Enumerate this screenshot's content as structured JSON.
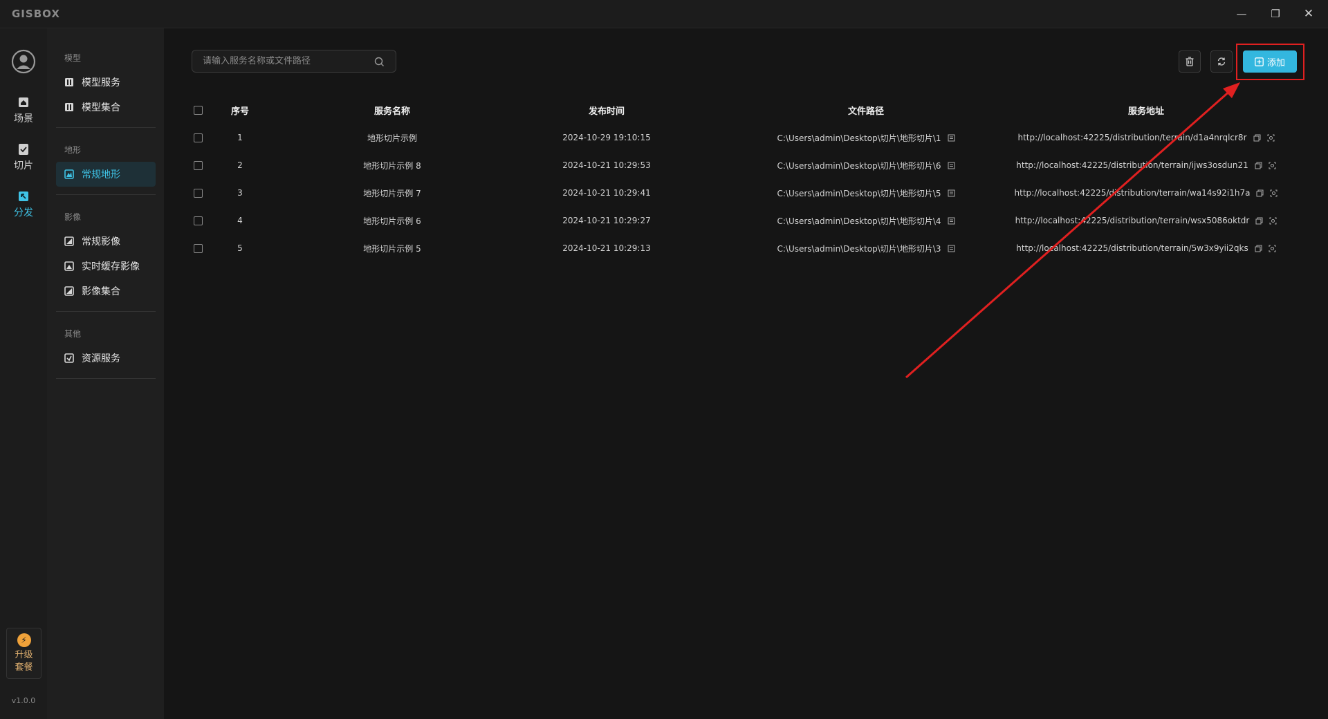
{
  "app": {
    "logo": "GISBOX"
  },
  "window_controls": {
    "minimize": "—",
    "maximize": "❐",
    "close": "✕"
  },
  "rail": {
    "items": [
      {
        "label": "场景",
        "icon": "home-icon"
      },
      {
        "label": "切片",
        "icon": "slice-icon"
      },
      {
        "label": "分发",
        "icon": "distribute-icon",
        "active": true
      }
    ],
    "upgrade_label": "升级套餐",
    "version": "v1.0.0"
  },
  "subnav": {
    "sections": [
      {
        "title": "模型",
        "items": [
          "模型服务",
          "模型集合"
        ]
      },
      {
        "title": "地形",
        "items": [
          "常规地形"
        ]
      },
      {
        "title": "影像",
        "items": [
          "常规影像",
          "实时缓存影像",
          "影像集合"
        ]
      },
      {
        "title": "其他",
        "items": [
          "资源服务"
        ]
      }
    ],
    "active_item": "常规地形"
  },
  "toolbar": {
    "search_placeholder": "请输入服务名称或文件路径",
    "add_label": "添加"
  },
  "table": {
    "headers": [
      "序号",
      "服务名称",
      "发布时间",
      "文件路径",
      "服务地址"
    ],
    "rows": [
      {
        "idx": "1",
        "name": "地形切片示例",
        "time": "2024-10-29 19:10:15",
        "path": "C:\\Users\\admin\\Desktop\\切片\\地形切片\\1",
        "url": "http://localhost:42225/distribution/terrain/d1a4nrqlcr8r"
      },
      {
        "idx": "2",
        "name": "地形切片示例 8",
        "time": "2024-10-21 10:29:53",
        "path": "C:\\Users\\admin\\Desktop\\切片\\地形切片\\6",
        "url": "http://localhost:42225/distribution/terrain/ijws3osdun21"
      },
      {
        "idx": "3",
        "name": "地形切片示例 7",
        "time": "2024-10-21 10:29:41",
        "path": "C:\\Users\\admin\\Desktop\\切片\\地形切片\\5",
        "url": "http://localhost:42225/distribution/terrain/wa14s92i1h7a"
      },
      {
        "idx": "4",
        "name": "地形切片示例 6",
        "time": "2024-10-21 10:29:27",
        "path": "C:\\Users\\admin\\Desktop\\切片\\地形切片\\4",
        "url": "http://localhost:42225/distribution/terrain/wsx5086oktdr"
      },
      {
        "idx": "5",
        "name": "地形切片示例 5",
        "time": "2024-10-21 10:29:13",
        "path": "C:\\Users\\admin\\Desktop\\切片\\地形切片\\3",
        "url": "http://localhost:42225/distribution/terrain/5w3x9yii2qks"
      }
    ]
  },
  "colors": {
    "accent": "#3fc3e6",
    "add_button": "#33b7df",
    "annotation": "#e02020",
    "upgrade": "#f0a23a"
  }
}
